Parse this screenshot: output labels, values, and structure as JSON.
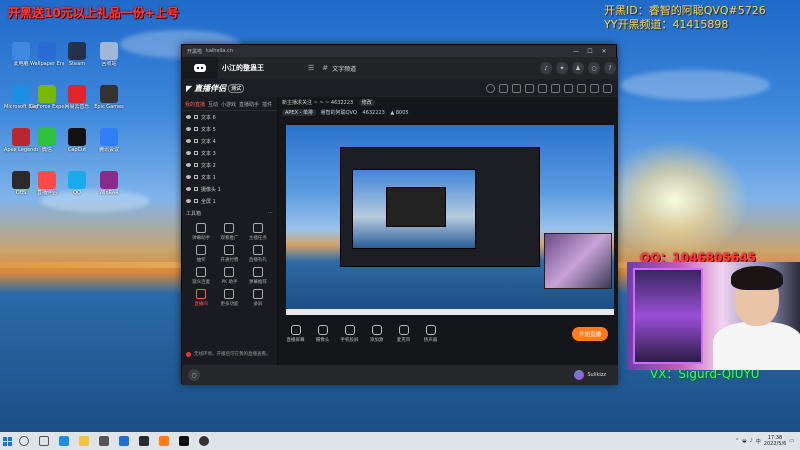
{
  "overlay": {
    "top_left_banner": "开黑送10元以上礼品一份+上号",
    "kaihei_id": "开黑ID：睿智的阿聪QVQ#5726",
    "yy_channel": "YY开黑频道：41415898",
    "qq": "QQ：1046805645",
    "vx": "VX：Sigurd-QIUYU"
  },
  "desktop_icons": [
    {
      "label": "此电脑",
      "color": "#3f89e0"
    },
    {
      "label": "Wallpaper Engine",
      "color": "#2a6bd1"
    },
    {
      "label": "Steam",
      "color": "#23324a"
    },
    {
      "label": "回收站",
      "color": "#9fb8d8"
    },
    {
      "label": "Microsoft Edge",
      "color": "#1d8ee0"
    },
    {
      "label": "GeForce Experience",
      "color": "#76b900"
    },
    {
      "label": "网易云音乐",
      "color": "#e2232a"
    },
    {
      "label": "Epic Games",
      "color": "#333333"
    },
    {
      "label": "Apex Legends",
      "color": "#b8262e"
    },
    {
      "label": "微信",
      "color": "#2fbf3e"
    },
    {
      "label": "CapCut",
      "color": "#111111"
    },
    {
      "label": "腾讯会议",
      "color": "#2f7ef5"
    },
    {
      "label": "OBS",
      "color": "#2a2a2a"
    },
    {
      "label": "直播伴侣",
      "color": "#ff4a4a"
    },
    {
      "label": "QQ",
      "color": "#1aabee"
    },
    {
      "label": "WinRAR",
      "color": "#8b2a8b"
    }
  ],
  "app_window": {
    "url": "kaiheila.cn",
    "title_prefix": "开黑啦",
    "server_name": "小江的整蛊王",
    "channel": "文字频道"
  },
  "streamer": {
    "logo_text": "直播伴侣",
    "logo_badge": "测试",
    "tabs": [
      "我的直播",
      "互动",
      "小游戏",
      "直播助手",
      "插件"
    ],
    "layers": [
      {
        "label": "文本 6"
      },
      {
        "label": "文本 5"
      },
      {
        "label": "文本 4"
      },
      {
        "label": "文本 3"
      },
      {
        "label": "文本 2"
      },
      {
        "label": "文本 1"
      },
      {
        "label": "摄像头 1"
      },
      {
        "label": "全屏 1"
      }
    ],
    "tools_title": "工具箱",
    "tools": [
      {
        "label": "弹幕助手"
      },
      {
        "label": "观看推广"
      },
      {
        "label": "主播任务"
      },
      {
        "label": "抽奖"
      },
      {
        "label": "开通付费"
      },
      {
        "label": "直播有礼"
      },
      {
        "label": "观众连麦"
      },
      {
        "label": "PK 助手"
      },
      {
        "label": "弹幕推荐"
      },
      {
        "label": "直播间"
      },
      {
        "label": "更多功能"
      },
      {
        "label": "录屏"
      }
    ],
    "room_title": "新主播求关注 ~ ~ ~ 4632223",
    "room_badge": "修改",
    "room_category": "APEX - 单排",
    "room_host": "睿智的阿聪QVQ",
    "room_id": "4632223",
    "room_hot": "8005",
    "controls": [
      {
        "label": "直播屏幕"
      },
      {
        "label": "摄像头"
      },
      {
        "label": "手机投屏"
      },
      {
        "label": "添加源"
      },
      {
        "label": "麦克风"
      },
      {
        "label": "扬声器"
      }
    ],
    "go_live": "开始直播",
    "notice": "无线环境，开播后可在我的直播查看。",
    "chat_user": "Sulikizz"
  },
  "taskbar": {
    "time": "17:38",
    "date": "2022/5/6"
  }
}
